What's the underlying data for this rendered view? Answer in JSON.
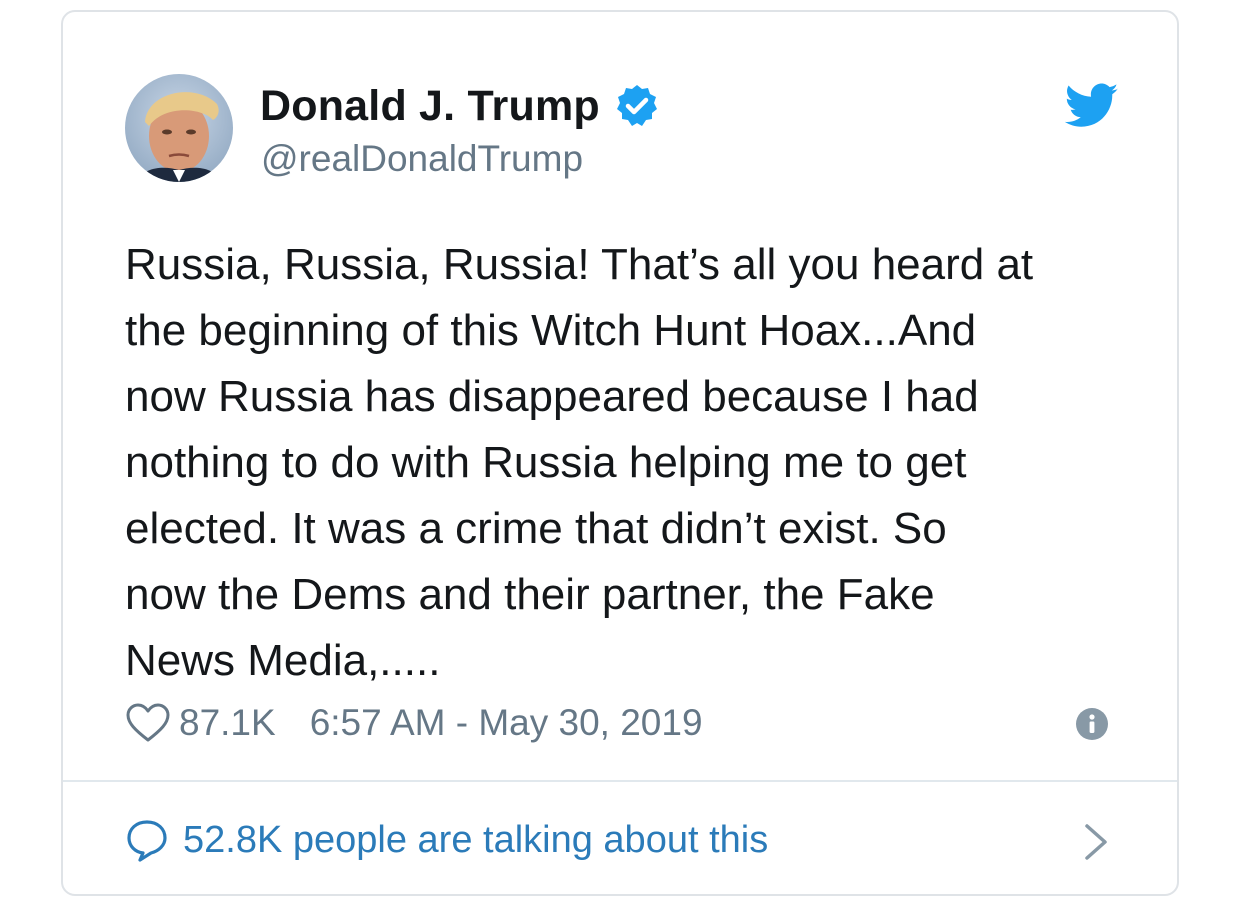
{
  "tweet": {
    "display_name": "Donald J. Trump",
    "handle": "@realDonaldTrump",
    "text": "Russia, Russia, Russia! That’s all you heard at\nthe beginning of this Witch Hunt Hoax...And\nnow Russia has disappeared because I had\nnothing to do with Russia helping me to get\nelected. It was a crime that didn’t exist. So\nnow the Dems and their partner, the Fake\nNews Media,.....",
    "likes": "87.1K",
    "timestamp": "6:57 AM - May 30, 2019",
    "talking_count": "52.8K",
    "talking_label": " people are talking about this"
  },
  "icons": {
    "verified": "verified-badge-icon",
    "brand": "twitter-bird-icon",
    "like": "heart-icon",
    "info": "info-icon",
    "reply": "speech-bubble-icon",
    "navigate": "chevron-right-icon"
  },
  "colors": {
    "brand_blue": "#1da1f2",
    "link_blue": "#2b7bb9",
    "text": "#14171a",
    "muted": "#657786"
  }
}
